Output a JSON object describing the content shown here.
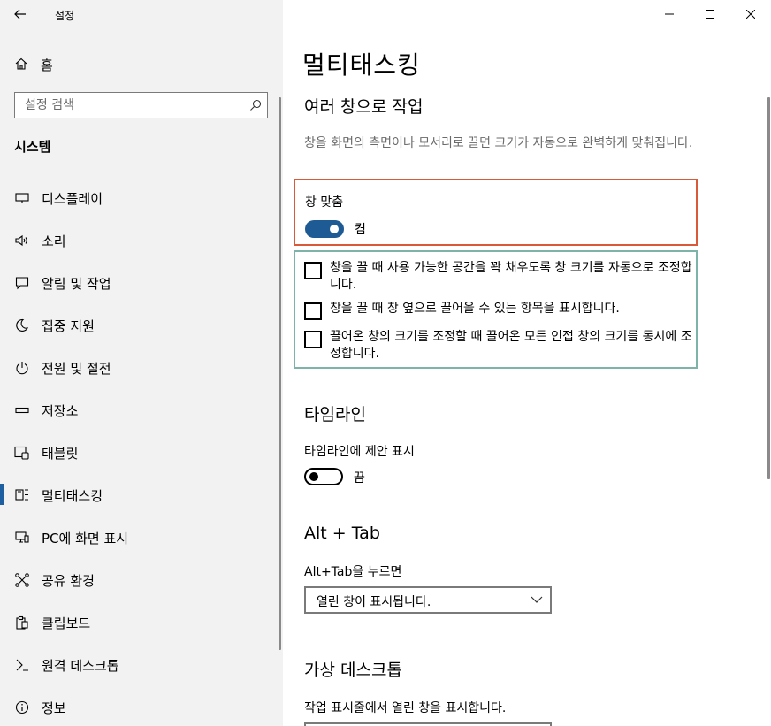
{
  "app": {
    "title": "설정"
  },
  "sidebar": {
    "home_label": "홈",
    "search_placeholder": "설정 검색",
    "section_title": "시스템",
    "items": [
      {
        "label": "디스플레이",
        "icon": "monitor-icon"
      },
      {
        "label": "소리",
        "icon": "speaker-icon"
      },
      {
        "label": "알림 및 작업",
        "icon": "notification-icon"
      },
      {
        "label": "집중 지원",
        "icon": "moon-icon"
      },
      {
        "label": "전원 및 절전",
        "icon": "power-icon"
      },
      {
        "label": "저장소",
        "icon": "storage-icon"
      },
      {
        "label": "태블릿",
        "icon": "tablet-icon"
      },
      {
        "label": "멀티태스킹",
        "icon": "multitasking-icon",
        "active": true
      },
      {
        "label": "PC에 화면 표시",
        "icon": "project-icon"
      },
      {
        "label": "공유 환경",
        "icon": "share-icon"
      },
      {
        "label": "클립보드",
        "icon": "clipboard-icon"
      },
      {
        "label": "원격 데스크톱",
        "icon": "remote-desktop-icon"
      },
      {
        "label": "정보",
        "icon": "info-icon"
      }
    ]
  },
  "main": {
    "page_title": "멀티태스킹",
    "section_windows": {
      "title": "여러 창으로 작업",
      "description": "창을 화면의 측면이나 모서리로 끌면 크기가 자동으로 완벽하게 맞춰집니다.",
      "snap_label": "창 맞춤",
      "snap_state": "켬",
      "snap_on": true,
      "options": [
        {
          "label": "창을 끌 때 사용 가능한 공간을 꽉 채우도록 창 크기를 자동으로 조정합니다.",
          "checked": false
        },
        {
          "label": "창을 끌 때 창 옆으로 끌어올 수 있는 항목을 표시합니다.",
          "checked": false
        },
        {
          "label": "끌어온 창의 크기를 조정할 때 끌어온 모든 인접 창의 크기를 동시에 조정합니다.",
          "checked": false
        }
      ]
    },
    "section_timeline": {
      "title": "타임라인",
      "setting_label": "타임라인에 제안 표시",
      "state": "끔",
      "on": false
    },
    "section_alttab": {
      "title": "Alt + Tab",
      "setting_label": "Alt+Tab을 누르면",
      "selected_value": "열린 창이 표시됩니다."
    },
    "section_virtual": {
      "title": "가상 데스크톱",
      "setting_label": "작업 표시줄에서 열린 창을 표시합니다."
    }
  },
  "colors": {
    "accent": "#1e5a94",
    "sidebar_bg": "#f2f2f2",
    "highlight_red": "#d85a3a",
    "highlight_teal": "#7db3a8"
  }
}
